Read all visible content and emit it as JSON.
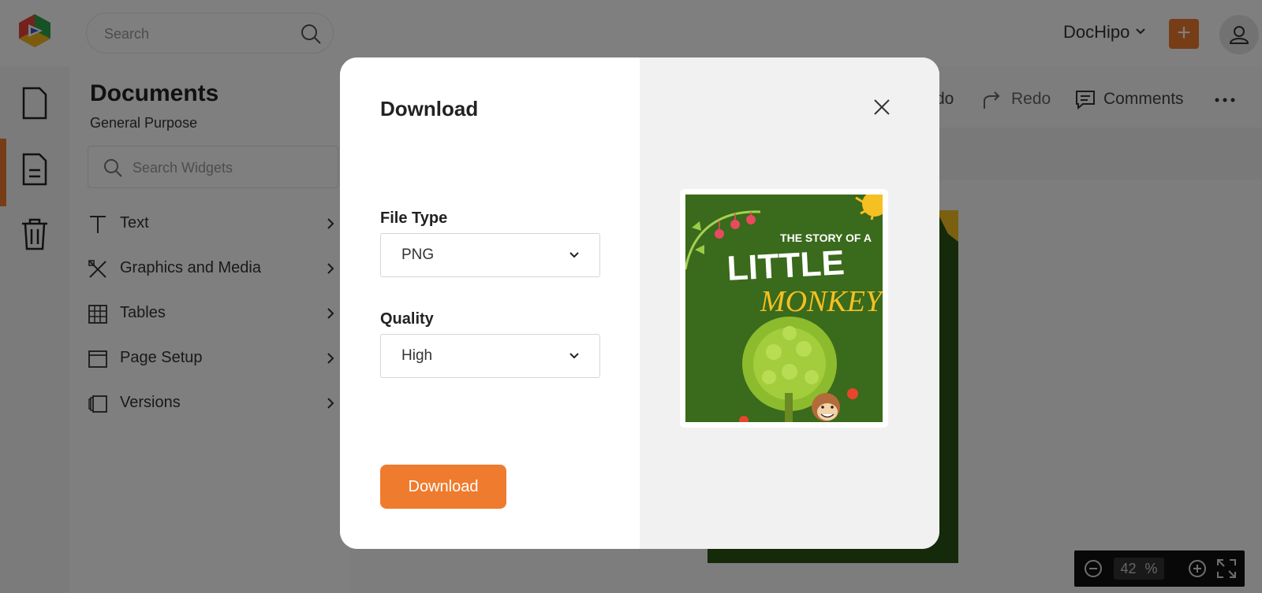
{
  "header": {
    "search_placeholder": "Search",
    "account_name": "DocHipo",
    "add_label": "+"
  },
  "panel": {
    "title": "Documents",
    "subtitle": "General Purpose",
    "widget_search_placeholder": "Search Widgets",
    "items": [
      {
        "label": "Text",
        "icon": "text-icon"
      },
      {
        "label": "Graphics and Media",
        "icon": "graphics-icon"
      },
      {
        "label": "Tables",
        "icon": "table-icon"
      },
      {
        "label": "Page Setup",
        "icon": "page-setup-icon"
      },
      {
        "label": "Versions",
        "icon": "versions-icon"
      }
    ]
  },
  "toolbar": {
    "undo_partial": "do",
    "redo_label": "Redo",
    "comments_label": "Comments"
  },
  "zoom": {
    "value": "42",
    "unit": "%"
  },
  "modal": {
    "title": "Download",
    "file_type_label": "File Type",
    "file_type_value": "PNG",
    "quality_label": "Quality",
    "quality_value": "High",
    "download_label": "Download",
    "preview": {
      "line1": "THE STORY OF A",
      "line2": "LITTLE",
      "line3": "MONKEY"
    }
  },
  "colors": {
    "accent": "#ef7b2e",
    "preview_bg": "#3a6a1c",
    "preview_title_yellow": "#f5c021"
  }
}
